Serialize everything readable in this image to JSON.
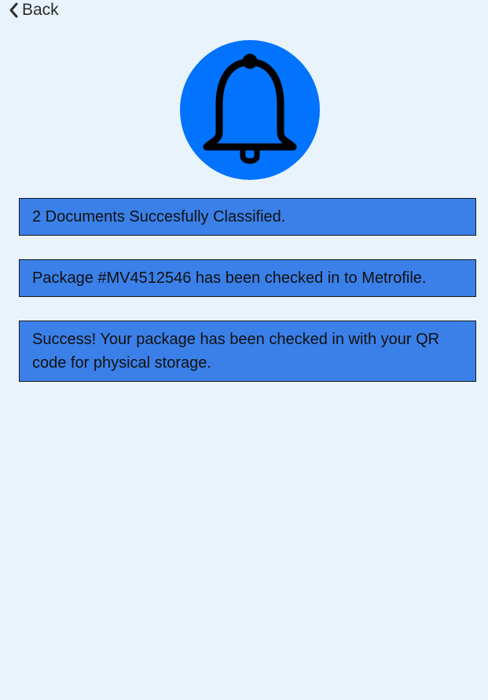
{
  "nav": {
    "back_label": "Back"
  },
  "header": {
    "icon": "bell-icon",
    "icon_bg_color": "#0173ff"
  },
  "notifications": [
    {
      "text": "2 Documents Succesfully Classified."
    },
    {
      "text": "Package #MV4512546 has been checked in to Metrofile."
    },
    {
      "text": "Success! Your package has been checked in with your QR code for physical storage."
    }
  ],
  "colors": {
    "page_background": "#e8f3fb",
    "notification_background": "#3b80e8"
  }
}
